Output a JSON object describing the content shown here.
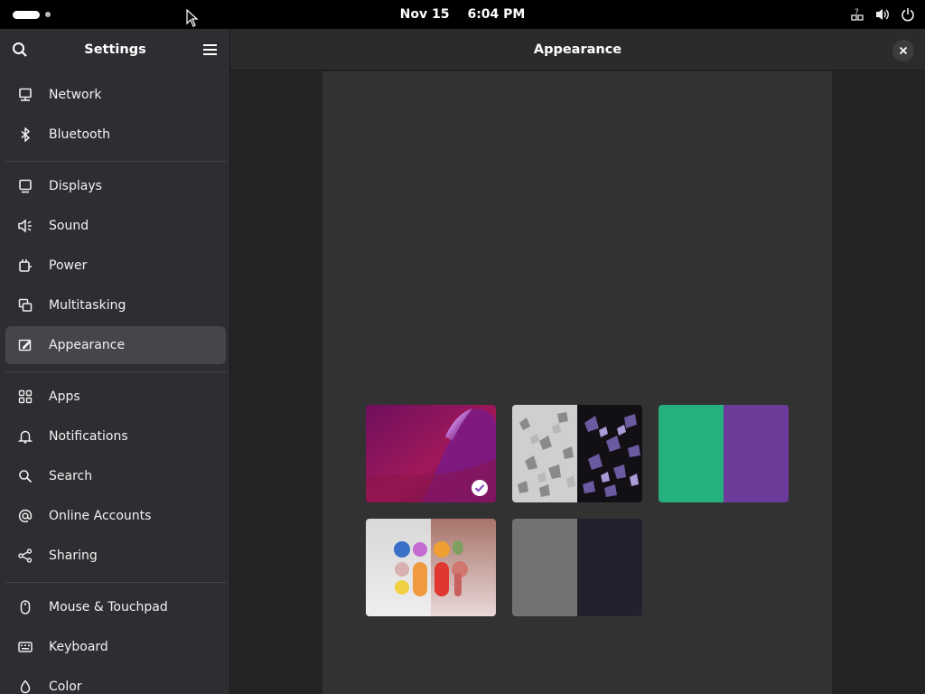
{
  "topbar": {
    "date": "Nov 15",
    "time": "6:04 PM",
    "icons": [
      "activities-indicator",
      "accessibility-icon",
      "volume-icon",
      "power-icon"
    ]
  },
  "sidebar": {
    "title": "Settings",
    "items": [
      {
        "label": "Network",
        "icon": "network-icon"
      },
      {
        "label": "Bluetooth",
        "icon": "bluetooth-icon"
      },
      {
        "label": "Displays",
        "icon": "display-icon"
      },
      {
        "label": "Sound",
        "icon": "sound-icon"
      },
      {
        "label": "Power",
        "icon": "power-plug-icon"
      },
      {
        "label": "Multitasking",
        "icon": "multitasking-icon"
      },
      {
        "label": "Appearance",
        "icon": "appearance-icon",
        "active": true
      },
      {
        "label": "Apps",
        "icon": "apps-grid-icon"
      },
      {
        "label": "Notifications",
        "icon": "bell-icon"
      },
      {
        "label": "Search",
        "icon": "search-icon"
      },
      {
        "label": "Online Accounts",
        "icon": "at-sign-icon"
      },
      {
        "label": "Sharing",
        "icon": "share-icon"
      },
      {
        "label": "Mouse & Touchpad",
        "icon": "mouse-icon"
      },
      {
        "label": "Keyboard",
        "icon": "keyboard-icon"
      },
      {
        "label": "Color",
        "icon": "color-icon"
      }
    ]
  },
  "main": {
    "title": "Appearance",
    "wallpapers": [
      {
        "name": "purple-wave",
        "selected": true
      },
      {
        "name": "crystals"
      },
      {
        "name": "green-purple"
      },
      {
        "name": "pills"
      },
      {
        "name": "gray-dark"
      }
    ]
  },
  "colors": {
    "accent": "#8a4bbf",
    "sidebar_bg": "#2e2e32",
    "main_bg": "#242424",
    "panel_bg": "#323232"
  }
}
